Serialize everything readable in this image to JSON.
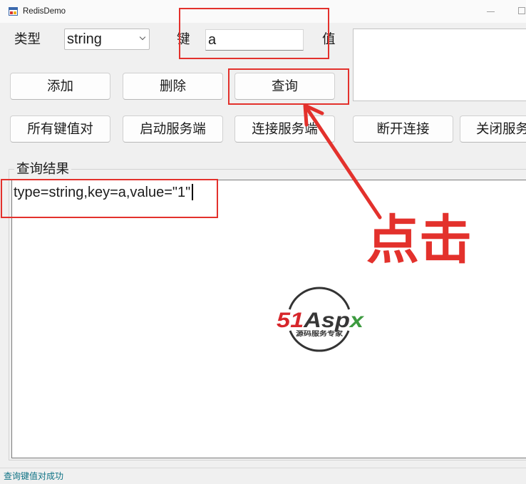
{
  "window": {
    "title": "RedisDemo",
    "app_icon": "app-icon",
    "minimize_icon": "minimize-icon",
    "maximize_icon": "maximize-icon"
  },
  "form": {
    "type_label": "类型",
    "type_value": "string",
    "type_dropdown_icon": "chevron-down-icon",
    "key_label": "键",
    "key_value": "a",
    "value_label": "值"
  },
  "buttons": {
    "add": "添加",
    "delete": "删除",
    "query": "查询",
    "all_pairs": "所有键值对",
    "start_server": "启动服务端",
    "connect_server": "连接服务端",
    "disconnect": "断开连接",
    "close_service": "关闭服务"
  },
  "result": {
    "group_label": "查询结果",
    "text": "type=string,key=a,value=\"1\""
  },
  "annotation": {
    "label": "点击",
    "color": "#e3312c"
  },
  "watermark": {
    "number": "51",
    "word": "Asp",
    "tail": "x",
    "tagline": "源码服务专家"
  },
  "status_bar": {
    "message": "查询键值对成功",
    "color": "#0e7285"
  }
}
